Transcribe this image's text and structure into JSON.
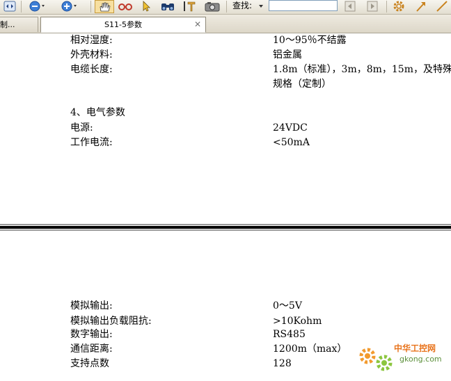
{
  "toolbar": {
    "find_label": "查找:",
    "find_value": "",
    "icons": [
      "nav-arrows-icon",
      "zoom-out-icon",
      "zoom-in-icon",
      "hand-tool-icon",
      "glasses-icon",
      "select-arrow-icon",
      "binoculars-icon",
      "text-select-icon",
      "snapshot-icon",
      "prev-result-icon",
      "next-result-icon",
      "gear-icon",
      "arrow-tool-icon",
      "line-tool-icon"
    ]
  },
  "tabs": [
    {
      "label": "制..."
    },
    {
      "label": "S11-5参数",
      "active": true
    }
  ],
  "doc": {
    "top_block": [
      {
        "label": "相对湿度:",
        "value": "10～95％不结露"
      },
      {
        "label": "外壳材料:",
        "value": "铝金属"
      },
      {
        "label": "电缆长度:",
        "value": "1.8m（标准），3m，8m，15m，及特殊",
        "value2": "规格（定制）"
      }
    ],
    "section_title": "4、电气参数",
    "electrical": [
      {
        "label": "电源:",
        "value": "24VDC"
      },
      {
        "label": "工作电流:",
        "value": "<50mA"
      }
    ],
    "bottom_block": [
      {
        "label": "模拟输出:",
        "value": "0～5V"
      },
      {
        "label": "模拟输出负载阻抗:",
        "value": ">10Kohm"
      },
      {
        "label": "数字输出:",
        "value": "RS485"
      },
      {
        "label": "通信距离:",
        "value": "1200m（max）"
      },
      {
        "label": "支持点数",
        "value": "128"
      }
    ]
  },
  "watermark": {
    "line1": "中华工控网",
    "line2": "gkong.com"
  }
}
